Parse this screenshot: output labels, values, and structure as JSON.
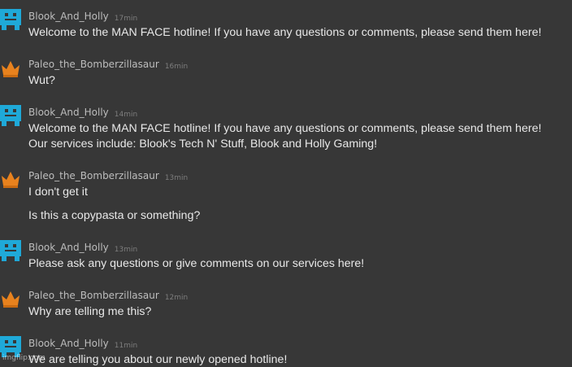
{
  "colors": {
    "background": "#373737",
    "blook_avatar": "#1fa9d8",
    "paleo_avatar": "#e8821e"
  },
  "messages": [
    {
      "username": "Blook_And_Holly",
      "timestamp": "17min",
      "avatar_icon": "blue-pixel-robot-icon",
      "lines": [
        "Welcome to the MAN FACE hotline! If you have any questions or comments, please send them here!"
      ]
    },
    {
      "username": "Paleo_the_Bomberzillasaur",
      "timestamp": "16min",
      "avatar_icon": "orange-crown-icon",
      "lines": [
        "Wut?"
      ]
    },
    {
      "username": "Blook_And_Holly",
      "timestamp": "14min",
      "avatar_icon": "blue-pixel-robot-icon",
      "lines": [
        "Welcome to the MAN FACE hotline! If you have any questions or comments, please send them here!",
        "Our services include: Blook's Tech N' Stuff, Blook and Holly Gaming!"
      ]
    },
    {
      "username": "Paleo_the_Bomberzillasaur",
      "timestamp": "13min",
      "avatar_icon": "orange-crown-icon",
      "lines": [
        "I don't get it",
        "Is this a copypasta or something?"
      ]
    },
    {
      "username": "Blook_And_Holly",
      "timestamp": "13min",
      "avatar_icon": "blue-pixel-robot-icon",
      "lines": [
        "Please ask any questions or give comments on our services here!"
      ]
    },
    {
      "username": "Paleo_the_Bomberzillasaur",
      "timestamp": "12min",
      "avatar_icon": "orange-crown-icon",
      "lines": [
        "Why are telling me this?"
      ]
    },
    {
      "username": "Blook_And_Holly",
      "timestamp": "11min",
      "avatar_icon": "blue-pixel-robot-icon",
      "lines": [
        "We are telling you about our newly opened hotline!"
      ]
    }
  ],
  "watermark": "imgflip.com"
}
